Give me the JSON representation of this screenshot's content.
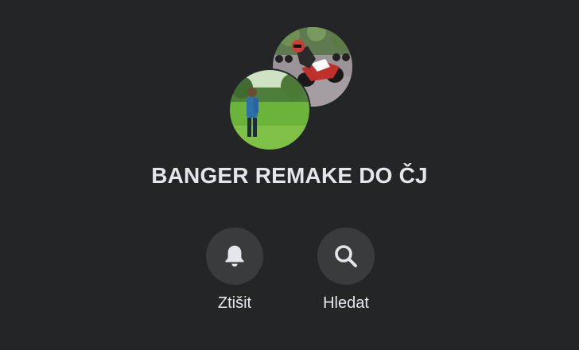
{
  "conversation": {
    "title": "BANGER REMAKE DO ČJ",
    "avatars": [
      {
        "name": "motorcycle-rider-photo"
      },
      {
        "name": "person-on-grass-photo"
      }
    ]
  },
  "actions": {
    "mute": {
      "label": "Ztišit",
      "icon": "bell-icon"
    },
    "search": {
      "label": "Hledat",
      "icon": "search-icon"
    }
  },
  "colors": {
    "background": "#242526",
    "button_bg": "#3a3b3c",
    "text": "#e4e6eb"
  }
}
